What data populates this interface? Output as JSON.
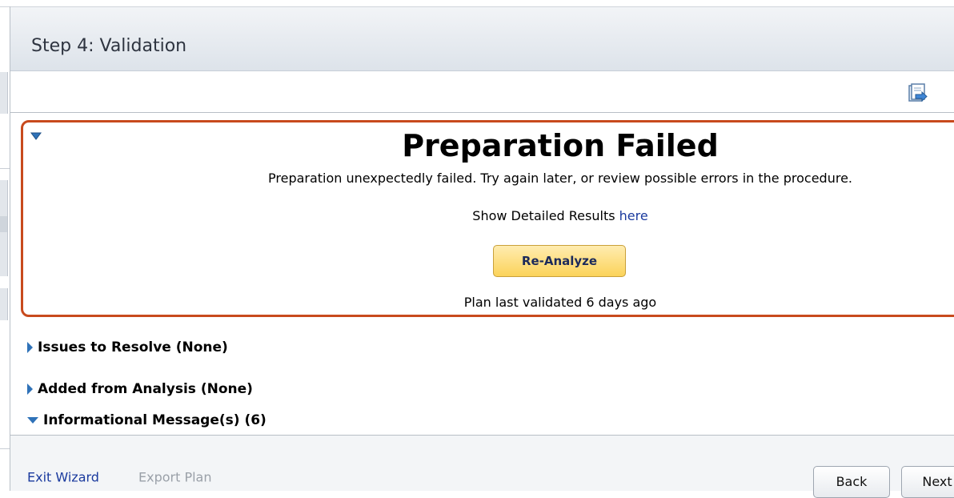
{
  "title": "Step 4: Validation",
  "status": {
    "heading": "Preparation Failed",
    "description": "Preparation unexpectedly failed. Try again later, or review possible errors in the procedure.",
    "detail_prefix": "Show Detailed Results",
    "detail_link": "here",
    "reanalyze_label": "Re-Analyze",
    "validated_text": "Plan last validated 6 days ago"
  },
  "sections": {
    "issues": "Issues to Resolve (None)",
    "added": "Added from Analysis (None)",
    "info": "Informational Message(s) (6)"
  },
  "footer": {
    "exit_label": "Exit Wizard",
    "export_label": "Export Plan",
    "back_label": "Back",
    "next_label": "Next"
  },
  "icons": {
    "export": "export-icon",
    "collapse": "triangle-down-icon",
    "expand": "triangle-right-icon"
  },
  "colors": {
    "error_border": "#c84a1d",
    "accent": "#2f72b8",
    "button": "#fbd35a",
    "link": "#1a3a9e"
  }
}
